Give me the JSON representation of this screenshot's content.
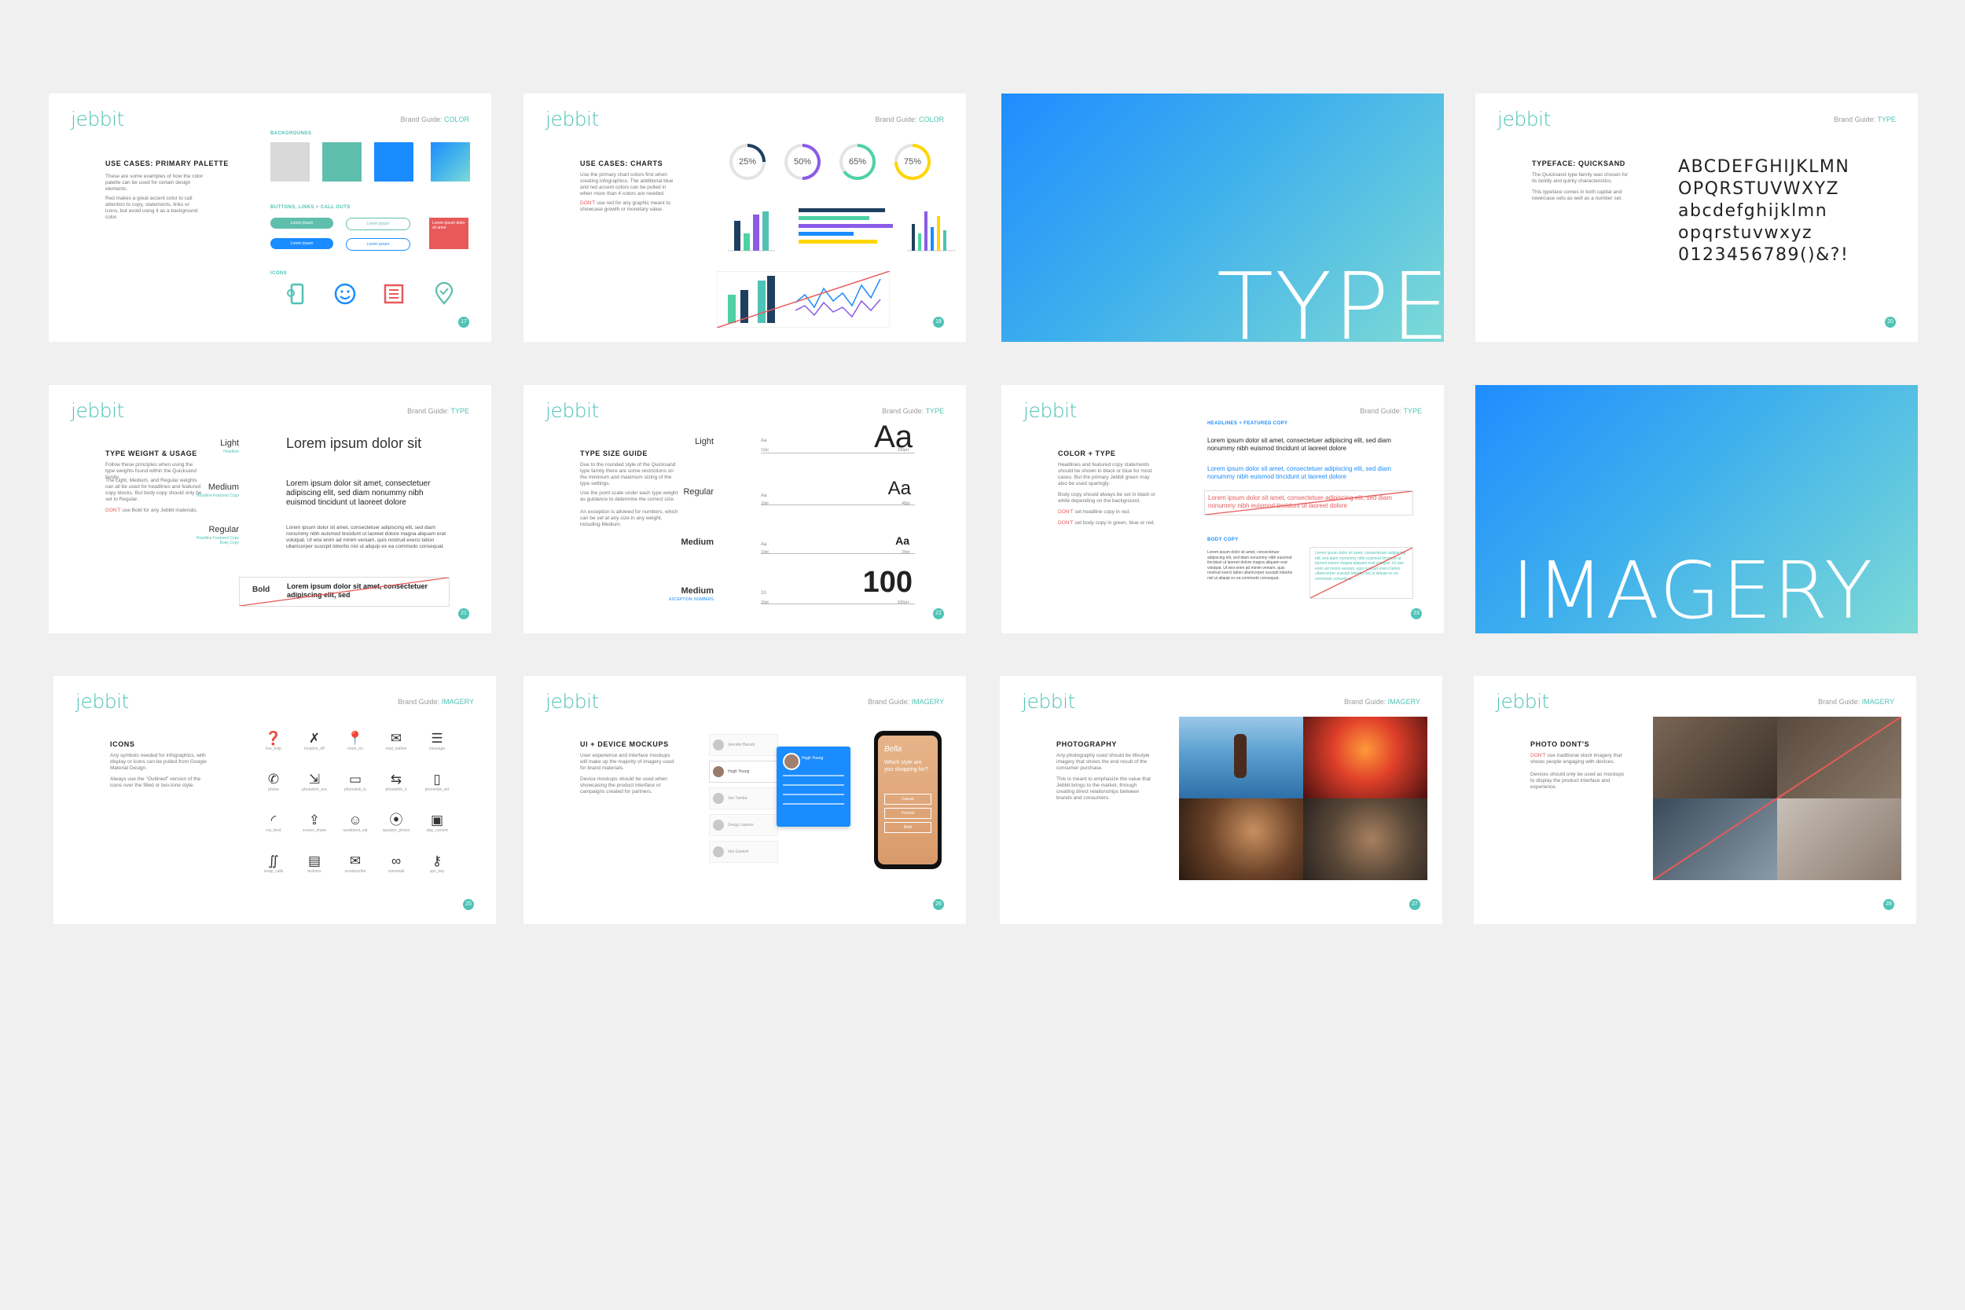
{
  "brand": {
    "logo": "jebbit",
    "guide_prefix": "Brand Guide: "
  },
  "colors": {
    "teal": "#4fc3b5",
    "blue": "#1a8cff",
    "red": "#e85a5a",
    "grey": "#d9d9d9"
  },
  "s1": {
    "section": "COLOR",
    "title": "USE CASES: PRIMARY PALETTE",
    "p1": "These are some examples of how the color palette can be used for certain design elements.",
    "p2": "Red makes a great accent color to call attention to copy, statements, links or icons, but avoid using it as a background color.",
    "h_bg": "BACKGROUNDS",
    "h_btn": "BUTTONS, LINKS + CALL OUTS",
    "h_icons": "ICONS",
    "pill": "Lorem ipsum",
    "callout": "Lorem ipsum dolor sit amet",
    "page": "17"
  },
  "s2": {
    "section": "COLOR",
    "title": "USE CASES: CHARTS",
    "p1": "Use the primary chart colors first when creating infographics. The additional blue and red accent colors can be pulled in when more than 4 colors are needed.",
    "dont": "DON'T",
    "p2": "use red for any graphic meant to showcase growth or monetary value.",
    "donuts": [
      "25%",
      "50%",
      "65%",
      "75%"
    ],
    "page": "18"
  },
  "s3": {
    "word": "TYPE"
  },
  "s4": {
    "section": "TYPE",
    "title": "TYPEFACE: QUICKSAND",
    "p1": "The Quicksand type family was chosen for its boldly and quirky characteristics.",
    "p2": "This typeface comes in both capital and lowercase sets as well as a number set.",
    "alpha": [
      "ABCDEFGHIJKLMN",
      "OPQRSTUVWXYZ",
      "abcdefghijklmn",
      "opqrstuvwxyz",
      "0123456789()&?!"
    ],
    "page": "20"
  },
  "s5": {
    "section": "TYPE",
    "title": "TYPE WEIGHT & USAGE",
    "p1": "Follow these principles when using the type weights found within the Quicksand family.",
    "p2": "The Light, Medium, and Regular weights can all be used for headlines and featured copy blocks. But body copy should only be set to Regular.",
    "dont": "DON'T",
    "p3": "use Bold for any Jebbit materials.",
    "w_light": "Light",
    "w_medium": "Medium",
    "w_regular": "Regular",
    "w_bold": "Bold",
    "sub_light": "Headline",
    "sub_medium": "Headline Featured Copy",
    "sub_regular": "Headline Featured Copy Body Copy",
    "t_light": "Lorem ipsum dolor sit",
    "t_medium": "Lorem ipsum dolor sit amet, consectetuer adipiscing elit, sed diam nonummy nibh euismod tincidunt ut laoreet dolore",
    "t_regular": "Lorem ipsum dolor sit amet, consectetuer adipiscing elit, sed diam nonummy nibh euismod tincidunt ut laoreet dolore magna aliquam erat volutpat. Ut wisi enim ad minim veniam, quis nostrud exerci tation ullamcorper suscipit lobortis nisl ut aliquip ex ea commodo consequat.",
    "t_bold": "Lorem ipsum dolor sit amet, consectetuer adipiscing elit, sed",
    "page": "21"
  },
  "s6": {
    "section": "TYPE",
    "title": "TYPE SIZE GUIDE",
    "p1": "Due to the rounded style of the Quicksand type family there are some restrictions on the minimum and maximum sizing of the type settings.",
    "p2": "Use the point scale under each type weight as guidance to determine the correct size.",
    "p3": "An exception is allowed for numbers, which can be set at any size in any weight, including Medium.",
    "rows": [
      {
        "w": "Light",
        "aa": "Aa",
        "min": "12pt",
        "max": "100pt+",
        "big": "Aa"
      },
      {
        "w": "Regular",
        "aa": "Aa",
        "min": "10pt",
        "max": "48pt",
        "big": "Aa"
      },
      {
        "w": "Medium",
        "aa": "Aa",
        "min": "10pt",
        "max": "24pt",
        "big": "Aa"
      },
      {
        "w": "Medium",
        "aa": "10",
        "min": "10pt",
        "max": "100pt+",
        "big": "100"
      }
    ],
    "exception": "EXCEPTION: NUMBERS",
    "page": "22"
  },
  "s7": {
    "section": "TYPE",
    "title": "COLOR + TYPE",
    "p1": "Headlines and featured copy statements should be shown in black or blue for most cases. But the primary Jebbit green may also be used sparingly.",
    "p2": "Body copy should always be set in black or white depending on the background.",
    "dont": "DON'T",
    "p3": "set headline copy in red.",
    "p4": "set body copy in green, blue or red.",
    "h1": "HEADLINES + FEATURED COPY",
    "hl": "Lorem ipsum dolor sit amet, consectetuer adipiscing elit, sed diam nonummy nibh euismod tincidunt ut laoreet dolore",
    "h2": "BODY COPY",
    "bc": "Lorem ipsum dolor sit amet, consectetuer adipiscing elit, sed diam nonummy nibh euismod tincidunt ut laoreet dolore magna aliquam erat volutpat. Ut wisi enim ad minim veniam, quis nostrud exerci tation ullamcorper suscipit lobortis nisl ut aliquip ex ea commodo consequat.",
    "page": "23"
  },
  "s8": {
    "word": "IMAGERY"
  },
  "s9": {
    "section": "IMAGERY",
    "title": "ICONS",
    "p1": "Any symbols needed for infographics, with display or icons can be pulled from Google Material Design.",
    "p2": "Always use the \"Outlined\" version of the icons over the filled or two-tone style.",
    "icons": [
      {
        "g": "❓",
        "n": "live_help"
      },
      {
        "g": "✗",
        "n": "location_off"
      },
      {
        "g": "📍",
        "n": "room_on"
      },
      {
        "g": "✉",
        "n": "mail_outline"
      },
      {
        "g": "☰",
        "n": "message"
      },
      {
        "g": "✆",
        "n": "phone"
      },
      {
        "g": "⇲",
        "n": "phonelink_era"
      },
      {
        "g": "▭",
        "n": "phonelink_lo"
      },
      {
        "g": "⇆",
        "n": "phonelink_ri"
      },
      {
        "g": "▯",
        "n": "phonelink_set"
      },
      {
        "g": "◜",
        "n": "rss_feed"
      },
      {
        "g": "⇪",
        "n": "screen_share"
      },
      {
        "g": "☺",
        "n": "sentiment_sat"
      },
      {
        "g": "⦿",
        "n": "speaker_phone"
      },
      {
        "g": "▣",
        "n": "stay_current"
      },
      {
        "g": "∬",
        "n": "swap_calls"
      },
      {
        "g": "▤",
        "n": "textsms"
      },
      {
        "g": "✉",
        "n": "unsubscribe"
      },
      {
        "g": "∞",
        "n": "voicemail"
      },
      {
        "g": "⚷",
        "n": "vpn_key"
      }
    ],
    "page": "25"
  },
  "s10": {
    "section": "IMAGERY",
    "title": "UI + DEVICE MOCKUPS",
    "p1": "User experience and interface mockups will make up the majority of imagery used for brand materials.",
    "p2": "Device mockups should be used when showcasing the product interface or campaigns created for partners.",
    "list": [
      "Jennifer Barrett",
      "Hugh Young",
      "Jan Tamba",
      "Gregg Lawson",
      "Iola Gaskell"
    ],
    "card": "Hugh Young",
    "phone": [
      "Bella",
      "Which style are you shopping for?",
      "Casual",
      "Formal",
      "Bold"
    ],
    "page": "26"
  },
  "s11": {
    "section": "IMAGERY",
    "title": "PHOTOGRAPHY",
    "p1": "Any photography used should be lifestyle imagery that shows the end result of the consumer purchase.",
    "p2": "This is meant to emphasize the value that Jebbit brings to the market, through creating direct relationships between brands and consumers.",
    "page": "27"
  },
  "s12": {
    "section": "IMAGERY",
    "title": "PHOTO DONT'S",
    "dont": "DON'T",
    "p1": "use traditional stock imagery that shows people engaging with devices.",
    "p2": "Devices should only be used as mockups to display the product interface and experience.",
    "page": "28"
  }
}
